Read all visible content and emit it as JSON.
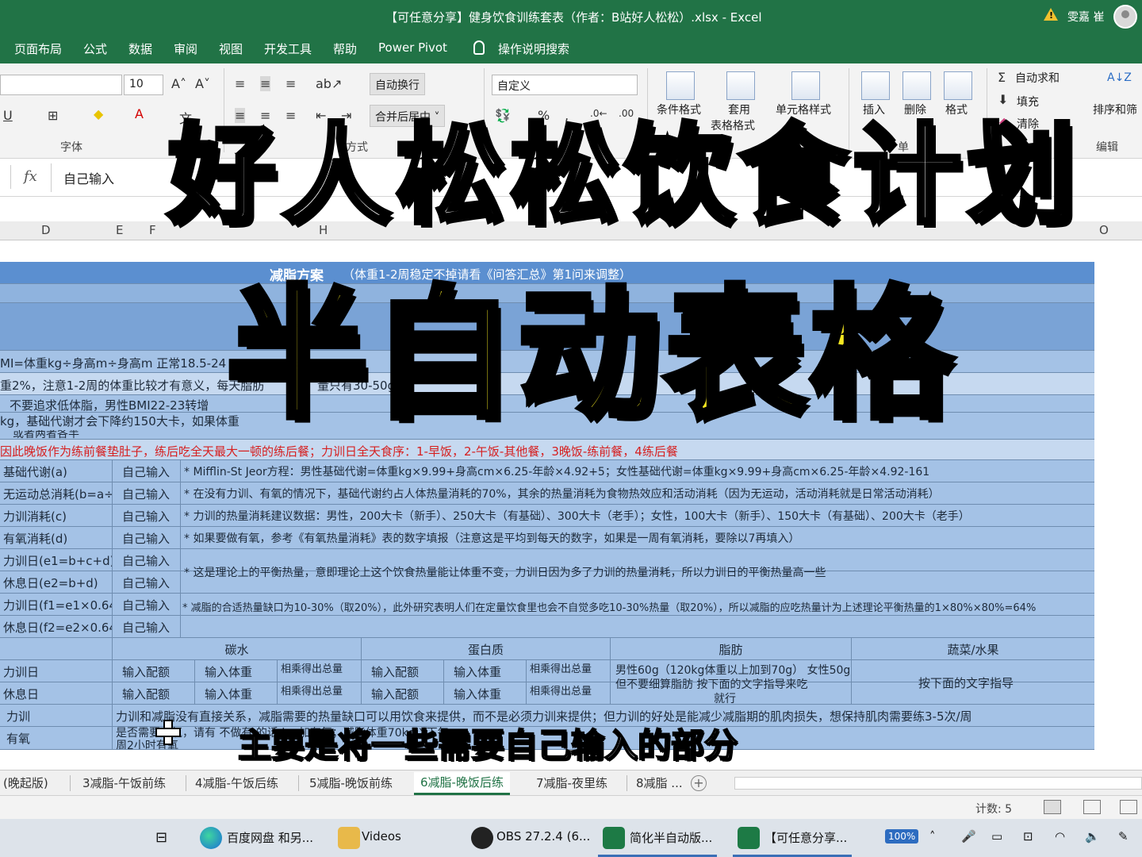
{
  "window": {
    "title": "【可任意分享】健身饮食训练套表（作者：B站好人松松）.xlsx  -  Excel",
    "user": "雯嘉 崔"
  },
  "ribbon_tabs": [
    "页面布局",
    "公式",
    "数据",
    "审阅",
    "视图",
    "开发工具",
    "帮助",
    "Power Pivot",
    "操作说明搜索"
  ],
  "ribbon": {
    "font_size": "10",
    "wrap_text": "自动换行",
    "merge_center": "合并后居中",
    "number_format": "自定义",
    "conditional_format": "条件格式",
    "table_format_line1": "套用",
    "table_format_line2": "表格格式",
    "cell_styles": "单元格样式",
    "insert": "插入",
    "delete": "删除",
    "format": "格式",
    "autosum": "自动求和",
    "fill": "填充",
    "clear": "清除",
    "sort_filter": "排序和筛",
    "group_font": "字体",
    "group_align_partial": "方式",
    "group_cells_partial": "单",
    "group_edit": "编辑",
    "percent": "%"
  },
  "formula_bar": {
    "fx": "fx",
    "content": "自己输入"
  },
  "columns": [
    "D",
    "E",
    "F",
    "H",
    "O"
  ],
  "sheet": {
    "banner_title": "减脂方案",
    "banner_note": "（体重1-2周稳定不掉请看《问答汇总》第1问来调整）",
    "bmi_line": "MI=体重kg÷身高m÷身高m  正常18.5-24",
    "line2": "重2%，注意1-2周的体重比较才有意义，每天脂肪",
    "line2b": "量只有30-50g",
    "line2c": "含水",
    "line3": "不要追求低体脂，男性BMI22-23转增",
    "line4": "kg，基础代谢才会下降约150大卡，如果体重",
    "line5": "或者两者各半",
    "red_line": "因此晚饭作为练前餐垫肚子，练后吃全天最大一顿的练后餐；力训日全天食序：1-早饭，2-午饭-其他餐，3晚饭-练前餐，4练后餐",
    "rows": [
      {
        "label": "基础代谢(a)",
        "input": "自己输入",
        "note": "* Mifflin-St Jeor方程：男性基础代谢=体重kg×9.99+身高cm×6.25-年龄×4.92+5；女性基础代谢=体重kg×9.99+身高cm×6.25-年龄×4.92-161"
      },
      {
        "label": "无运动总消耗(b=a÷0.7)",
        "input": "自己输入",
        "note": "* 在没有力训、有氧的情况下，基础代谢约占人体热量消耗的70%，其余的热量消耗为食物热效应和活动消耗（因为无运动，活动消耗就是日常活动消耗）"
      },
      {
        "label": "力训消耗(c)",
        "input": "自己输入",
        "note": "* 力训的热量消耗建议数据：男性，200大卡（新手）、250大卡（有基础）、300大卡（老手）；女性，100大卡（新手）、150大卡（有基础）、200大卡（老手）"
      },
      {
        "label": "有氧消耗(d)",
        "input": "自己输入",
        "note": "* 如果要做有氧，参考《有氧热量消耗》表的数字填报（注意这是平均到每天的数字，如果是一周有氧消耗，要除以7再填入）"
      },
      {
        "label": "力训日(e1=b+c+d)",
        "input": "自己输入",
        "note": ""
      },
      {
        "label": "休息日(e2=b+d)",
        "input": "自己输入",
        "note": "* 这是理论上的平衡热量，意即理论上这个饮食热量能让体重不变，力训日因为多了力训的热量消耗，所以力训日的平衡热量高一些"
      },
      {
        "label": "力训日(f1=e1×0.64)",
        "input": "自己输入",
        "note": ""
      },
      {
        "label": "休息日(f2=e2×0.64)",
        "input": "自己输入",
        "note": "* 减脂的合适热量缺口为10-30%（取20%），此外研究表明人们在定量饮食里也会不自觉多吃10-30%热量（取20%），所以减脂的应吃热量计为上述理论平衡热量的1×80%×80%=64%"
      }
    ],
    "macro_headers": [
      "碳水",
      "蛋白质",
      "脂肪",
      "蔬菜/水果"
    ],
    "macro_rows": [
      {
        "label": "力训日",
        "c1": "输入配额",
        "c2": "输入体重",
        "c3": "相乘得出总量",
        "p1": "输入配额",
        "p2": "输入体重",
        "p3": "相乘得出总量"
      },
      {
        "label": "休息日",
        "c1": "输入配额",
        "c2": "输入体重",
        "c3": "相乘得出总量",
        "p1": "输入配额",
        "p2": "输入体重",
        "p3": "相乘得出总量"
      }
    ],
    "fat_note1": "男性60g（120kg体重以上加到70g）  女性50g",
    "fat_note2": "但不要细算脂肪 按下面的文字指导来吃",
    "fat_note3": "就行",
    "veg_note": "按下面的文字指导",
    "train_label": "力训",
    "train_note": "力训和减脂没有直接关系，减脂需要的热量缺口可以用饮食来提供，而不是必须力训来提供；但力训的好处是能减少减脂期的肌肉损失，想保持肌肉需要练3-5次/周",
    "cardio_label": "有氧",
    "cardio_note": "是否需要有氧，请有  不做有  的话  kg  加有氧；减脂体重70kg以下每",
    "cardio_note2": "周2小时有氧"
  },
  "sheet_tabs": [
    "(晚起版)",
    "3减脂-午饭前练",
    "4减脂-午饭后练",
    "5减脂-晚饭前练",
    "6减脂-晚饭后练",
    "7减脂-夜里练",
    "8减脂 ..."
  ],
  "status": {
    "count": "计数: 5"
  },
  "taskbar": {
    "items": [
      "百度网盘 和另...",
      "Videos",
      "OBS 27.2.4 (6...",
      "简化半自动版...",
      "【可任意分享..."
    ],
    "battery": "100%"
  },
  "overlay": {
    "title1": "好人松松饮食计划",
    "title2": "半自动表格",
    "subtitle": "主要是将一些需要自己输入的部分"
  }
}
